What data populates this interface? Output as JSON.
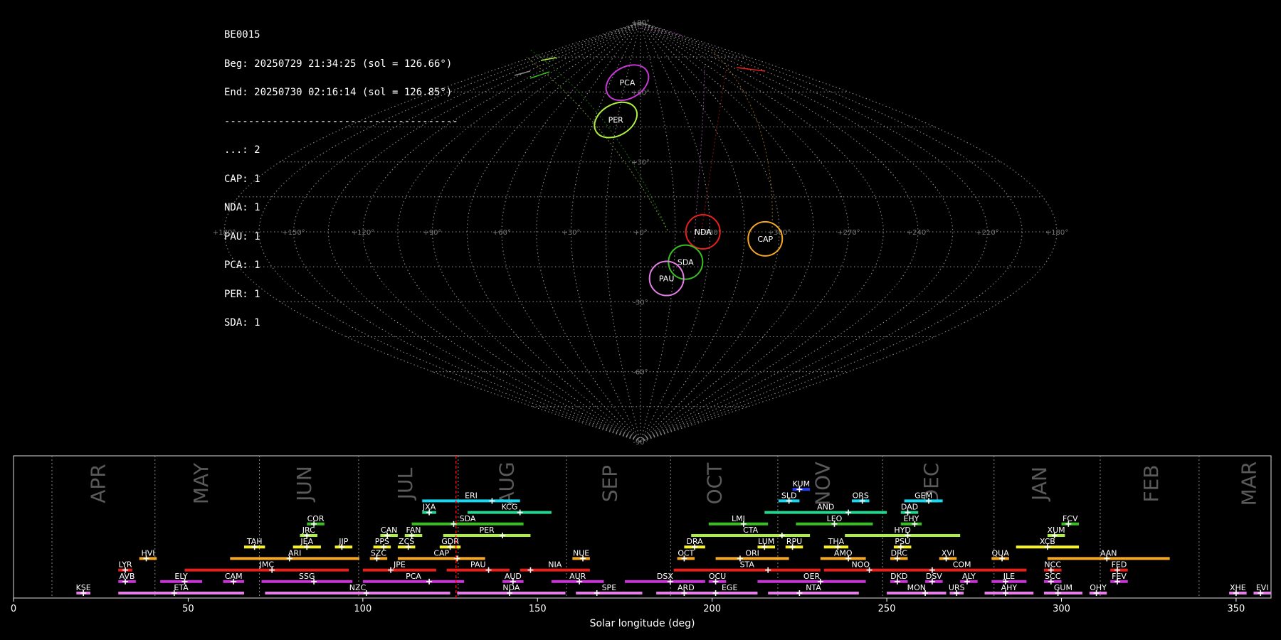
{
  "info_box": {
    "lines": [
      "BE0015",
      "Beg: 20250729 21:34:25 (sol = 126.66°)",
      "End: 20250730 02:16:14 (sol = 126.85°)",
      "---------------------------------------",
      "...: 2",
      "CAP: 1",
      "NDA: 1",
      "PAU: 1",
      "PCA: 1",
      "PER: 1",
      "SDA: 1"
    ]
  },
  "colors": {
    "background": "#000000",
    "grid": "#8a8a8a",
    "marker": "#ff0000",
    "month_label": "#5a5a5a",
    "tick": "#ffffff",
    "red": "#e8201c",
    "magenta": "#c837d6",
    "pink": "#e57ee6",
    "orange": "#f5a623",
    "yellow": "#f7f226",
    "lime": "#aef040",
    "green": "#39c020",
    "seagreen": "#20d890",
    "cyan": "#1ad8f0",
    "blue": "#2a3cf0"
  },
  "chart_data": [
    {
      "type": "scatter",
      "title": "",
      "projection": "sinusoidal",
      "lon_ticks": [
        "+180°",
        "+150°",
        "+120°",
        "+90°",
        "+60°",
        "+30°",
        "+0°",
        "+330°",
        "+300°",
        "+270°",
        "+240°",
        "+210°",
        "+180°"
      ],
      "lat_ticks": [
        "+90°",
        "+60°",
        "+30°",
        "+0°",
        "-30°",
        "-60°",
        "-90°"
      ],
      "radiants": [
        {
          "name": "PCA",
          "lon": 13,
          "lat": 64,
          "color": "magenta"
        },
        {
          "name": "PER",
          "lon": 16,
          "lat": 48,
          "color": "lime"
        },
        {
          "name": "NDA",
          "lon": 333,
          "lat": 0,
          "color": "red"
        },
        {
          "name": "CAP",
          "lon": 306,
          "lat": -3,
          "color": "orange"
        },
        {
          "name": "SDA",
          "lon": 340,
          "lat": -13,
          "color": "green"
        },
        {
          "name": "PAU",
          "lon": 348,
          "lat": -20,
          "color": "pink"
        }
      ]
    },
    {
      "type": "bar",
      "title": "",
      "xlabel": "Solar longitude (deg)",
      "xlim": [
        0,
        360
      ],
      "x_ticks": [
        0,
        50,
        100,
        150,
        200,
        250,
        300,
        350
      ],
      "current_sol": 126.66,
      "months": [
        {
          "label": "APR",
          "center": 24.5
        },
        {
          "label": "MAY",
          "center": 54
        },
        {
          "label": "JUN",
          "center": 83.5
        },
        {
          "label": "JUL",
          "center": 112.5
        },
        {
          "label": "AUG",
          "center": 141.5
        },
        {
          "label": "SEP",
          "center": 171
        },
        {
          "label": "OCT",
          "center": 201
        },
        {
          "label": "NOV",
          "center": 232
        },
        {
          "label": "DEC",
          "center": 263
        },
        {
          "label": "JAN",
          "center": 294
        },
        {
          "label": "FEB",
          "center": 326
        },
        {
          "label": "MAR",
          "center": 354
        }
      ],
      "month_boundaries": [
        11,
        40.5,
        70.4,
        98.8,
        127.3,
        158.3,
        188.1,
        218.8,
        248.8,
        280.7,
        311.1,
        339.4
      ],
      "showers": [
        {
          "code": "KUM",
          "start": 223,
          "end": 228,
          "peak": 225,
          "row": 9,
          "color": "blue"
        },
        {
          "code": "ERI",
          "start": 117,
          "end": 145,
          "peak": 137,
          "row": 8,
          "color": "cyan"
        },
        {
          "code": "SLD",
          "start": 219,
          "end": 225,
          "peak": 222,
          "row": 8,
          "color": "cyan"
        },
        {
          "code": "ORS",
          "start": 240,
          "end": 245,
          "peak": 243,
          "row": 8,
          "color": "cyan"
        },
        {
          "code": "GEM",
          "start": 255,
          "end": 266,
          "peak": 262,
          "row": 8,
          "color": "cyan"
        },
        {
          "code": "JXA",
          "start": 117,
          "end": 121,
          "peak": 119,
          "row": 7,
          "color": "seagreen"
        },
        {
          "code": "KCG",
          "start": 130,
          "end": 154,
          "peak": 145,
          "row": 7,
          "color": "seagreen"
        },
        {
          "code": "AND",
          "start": 215,
          "end": 250,
          "peak": 239,
          "row": 7,
          "color": "seagreen"
        },
        {
          "code": "DAD",
          "start": 254,
          "end": 259,
          "peak": 256,
          "row": 7,
          "color": "seagreen"
        },
        {
          "code": "COR",
          "start": 84,
          "end": 89,
          "peak": 86,
          "row": 6,
          "color": "green"
        },
        {
          "code": "SDA",
          "start": 114,
          "end": 146,
          "peak": 126,
          "row": 6,
          "color": "green"
        },
        {
          "code": "LMI",
          "start": 199,
          "end": 216,
          "peak": 209,
          "row": 6,
          "color": "green"
        },
        {
          "code": "LEO",
          "start": 224,
          "end": 246,
          "peak": 235,
          "row": 6,
          "color": "green"
        },
        {
          "code": "EHY",
          "start": 254,
          "end": 260,
          "peak": 258,
          "row": 6,
          "color": "green"
        },
        {
          "code": "FCV",
          "start": 300,
          "end": 305,
          "peak": 302,
          "row": 6,
          "color": "green"
        },
        {
          "code": "JRC",
          "start": 82,
          "end": 87,
          "peak": 84,
          "row": 5,
          "color": "lime"
        },
        {
          "code": "CAN",
          "start": 105,
          "end": 110,
          "peak": 107,
          "row": 5,
          "color": "lime"
        },
        {
          "code": "FAN",
          "start": 112,
          "end": 117,
          "peak": 114,
          "row": 5,
          "color": "lime"
        },
        {
          "code": "PER",
          "start": 123,
          "end": 148,
          "peak": 140,
          "row": 5,
          "color": "lime"
        },
        {
          "code": "CTA",
          "start": 194,
          "end": 228,
          "peak": 220,
          "row": 5,
          "color": "lime"
        },
        {
          "code": "HYD",
          "start": 238,
          "end": 271,
          "peak": 256,
          "row": 5,
          "color": "lime"
        },
        {
          "code": "XUM",
          "start": 296,
          "end": 301,
          "peak": 298,
          "row": 5,
          "color": "lime"
        },
        {
          "code": "TAH",
          "start": 66,
          "end": 72,
          "peak": 69,
          "row": 4,
          "color": "yellow"
        },
        {
          "code": "JEA",
          "start": 80,
          "end": 88,
          "peak": 84,
          "row": 4,
          "color": "yellow"
        },
        {
          "code": "JJP",
          "start": 92,
          "end": 97,
          "peak": 94,
          "row": 4,
          "color": "yellow"
        },
        {
          "code": "PPS",
          "start": 103,
          "end": 108,
          "peak": 106,
          "row": 4,
          "color": "yellow"
        },
        {
          "code": "ZCS",
          "start": 110,
          "end": 115,
          "peak": 113,
          "row": 4,
          "color": "yellow"
        },
        {
          "code": "GDR",
          "start": 122,
          "end": 128,
          "peak": 125,
          "row": 4,
          "color": "yellow"
        },
        {
          "code": "DRA",
          "start": 192,
          "end": 198,
          "peak": 195,
          "row": 4,
          "color": "yellow"
        },
        {
          "code": "LUM",
          "start": 213,
          "end": 218,
          "peak": 215,
          "row": 4,
          "color": "yellow"
        },
        {
          "code": "RPU",
          "start": 221,
          "end": 226,
          "peak": 223,
          "row": 4,
          "color": "yellow"
        },
        {
          "code": "THA",
          "start": 232,
          "end": 239,
          "peak": 236,
          "row": 4,
          "color": "yellow"
        },
        {
          "code": "PSU",
          "start": 252,
          "end": 257,
          "peak": 254,
          "row": 4,
          "color": "yellow"
        },
        {
          "code": "XCB",
          "start": 287,
          "end": 305,
          "peak": 296,
          "row": 4,
          "color": "yellow"
        },
        {
          "code": "HVI",
          "start": 36,
          "end": 41,
          "peak": 38,
          "row": 3,
          "color": "orange"
        },
        {
          "code": "ARI",
          "start": 62,
          "end": 99,
          "peak": 79,
          "row": 3,
          "color": "orange"
        },
        {
          "code": "SZC",
          "start": 102,
          "end": 107,
          "peak": 104,
          "row": 3,
          "color": "orange"
        },
        {
          "code": "CAP",
          "start": 110,
          "end": 135,
          "peak": 127,
          "row": 3,
          "color": "orange"
        },
        {
          "code": "NUE",
          "start": 160,
          "end": 165,
          "peak": 163,
          "row": 3,
          "color": "orange"
        },
        {
          "code": "OCT",
          "start": 190,
          "end": 195,
          "peak": 192,
          "row": 3,
          "color": "orange"
        },
        {
          "code": "ORI",
          "start": 201,
          "end": 222,
          "peak": 208,
          "row": 3,
          "color": "orange"
        },
        {
          "code": "AMO",
          "start": 231,
          "end": 244,
          "peak": 239,
          "row": 3,
          "color": "orange"
        },
        {
          "code": "DRC",
          "start": 251,
          "end": 256,
          "peak": 253,
          "row": 3,
          "color": "orange"
        },
        {
          "code": "XVI",
          "start": 265,
          "end": 270,
          "peak": 267,
          "row": 3,
          "color": "orange"
        },
        {
          "code": "QUA",
          "start": 280,
          "end": 285,
          "peak": 283,
          "row": 3,
          "color": "orange"
        },
        {
          "code": "AAN",
          "start": 296,
          "end": 331,
          "peak": 313,
          "row": 3,
          "color": "orange"
        },
        {
          "code": "LYR",
          "start": 30,
          "end": 34,
          "peak": 32,
          "row": 2,
          "color": "red"
        },
        {
          "code": "JMC",
          "start": 49,
          "end": 96,
          "peak": 74,
          "row": 2,
          "color": "red"
        },
        {
          "code": "JPE",
          "start": 100,
          "end": 121,
          "peak": 108,
          "row": 2,
          "color": "red"
        },
        {
          "code": "PAU",
          "start": 124,
          "end": 142,
          "peak": 136,
          "row": 2,
          "color": "red"
        },
        {
          "code": "NIA",
          "start": 145,
          "end": 165,
          "peak": 148,
          "row": 2,
          "color": "red"
        },
        {
          "code": "STA",
          "start": 189,
          "end": 231,
          "peak": 216,
          "row": 2,
          "color": "red"
        },
        {
          "code": "NOO",
          "start": 232,
          "end": 253,
          "peak": 245,
          "row": 2,
          "color": "red"
        },
        {
          "code": "COM",
          "start": 253,
          "end": 290,
          "peak": 263,
          "row": 2,
          "color": "red"
        },
        {
          "code": "NCC",
          "start": 295,
          "end": 300,
          "peak": 297,
          "row": 2,
          "color": "red"
        },
        {
          "code": "FED",
          "start": 314,
          "end": 319,
          "peak": 316,
          "row": 2,
          "color": "red"
        },
        {
          "code": "AVB",
          "start": 30,
          "end": 35,
          "peak": 32,
          "row": 1,
          "color": "magenta"
        },
        {
          "code": "ELY",
          "start": 42,
          "end": 54,
          "peak": 49,
          "row": 1,
          "color": "magenta"
        },
        {
          "code": "CAM",
          "start": 60,
          "end": 66,
          "peak": 63,
          "row": 1,
          "color": "magenta"
        },
        {
          "code": "SSG",
          "start": 71,
          "end": 97,
          "peak": 86,
          "row": 1,
          "color": "magenta"
        },
        {
          "code": "PCA",
          "start": 100,
          "end": 129,
          "peak": 119,
          "row": 1,
          "color": "magenta"
        },
        {
          "code": "AUD",
          "start": 140,
          "end": 146,
          "peak": 143,
          "row": 1,
          "color": "magenta"
        },
        {
          "code": "AUR",
          "start": 154,
          "end": 169,
          "peak": 162,
          "row": 1,
          "color": "magenta"
        },
        {
          "code": "DSX",
          "start": 175,
          "end": 198,
          "peak": 188,
          "row": 1,
          "color": "magenta"
        },
        {
          "code": "OCU",
          "start": 199,
          "end": 204,
          "peak": 201,
          "row": 1,
          "color": "magenta"
        },
        {
          "code": "OER",
          "start": 213,
          "end": 244,
          "peak": 231,
          "row": 1,
          "color": "magenta"
        },
        {
          "code": "DKD",
          "start": 251,
          "end": 256,
          "peak": 253,
          "row": 1,
          "color": "magenta"
        },
        {
          "code": "DSV",
          "start": 261,
          "end": 266,
          "peak": 263,
          "row": 1,
          "color": "magenta"
        },
        {
          "code": "ALY",
          "start": 271,
          "end": 276,
          "peak": 273,
          "row": 1,
          "color": "magenta"
        },
        {
          "code": "JLE",
          "start": 280,
          "end": 290,
          "peak": 284,
          "row": 1,
          "color": "magenta"
        },
        {
          "code": "SCC",
          "start": 295,
          "end": 300,
          "peak": 297,
          "row": 1,
          "color": "magenta"
        },
        {
          "code": "FEV",
          "start": 314,
          "end": 319,
          "peak": 316,
          "row": 1,
          "color": "magenta"
        },
        {
          "code": "KSE",
          "start": 18,
          "end": 22,
          "peak": 20,
          "row": 0,
          "color": "pink"
        },
        {
          "code": "ETA",
          "start": 30,
          "end": 66,
          "peak": 46,
          "row": 0,
          "color": "pink"
        },
        {
          "code": "NZC",
          "start": 72,
          "end": 125,
          "peak": 101,
          "row": 0,
          "color": "pink"
        },
        {
          "code": "NDA",
          "start": 127,
          "end": 158,
          "peak": 142,
          "row": 0,
          "color": "pink"
        },
        {
          "code": "SPE",
          "start": 161,
          "end": 180,
          "peak": 167,
          "row": 0,
          "color": "pink"
        },
        {
          "code": "ARD",
          "start": 184,
          "end": 201,
          "peak": 192,
          "row": 0,
          "color": "pink"
        },
        {
          "code": "EGE",
          "start": 197,
          "end": 213,
          "peak": 201,
          "row": 0,
          "color": "pink"
        },
        {
          "code": "NTA",
          "start": 216,
          "end": 242,
          "peak": 225,
          "row": 0,
          "color": "pink"
        },
        {
          "code": "MON",
          "start": 250,
          "end": 267,
          "peak": 261,
          "row": 0,
          "color": "pink"
        },
        {
          "code": "URS",
          "start": 268,
          "end": 272,
          "peak": 270,
          "row": 0,
          "color": "pink"
        },
        {
          "code": "AHY",
          "start": 278,
          "end": 292,
          "peak": 284,
          "row": 0,
          "color": "pink"
        },
        {
          "code": "GUM",
          "start": 295,
          "end": 306,
          "peak": 299,
          "row": 0,
          "color": "pink"
        },
        {
          "code": "OHY",
          "start": 308,
          "end": 313,
          "peak": 310,
          "row": 0,
          "color": "pink"
        },
        {
          "code": "XHE",
          "start": 348,
          "end": 353,
          "peak": 350,
          "row": 0,
          "color": "pink"
        },
        {
          "code": "EVI",
          "start": 355,
          "end": 360,
          "peak": 357,
          "row": 0,
          "color": "pink"
        }
      ]
    }
  ]
}
